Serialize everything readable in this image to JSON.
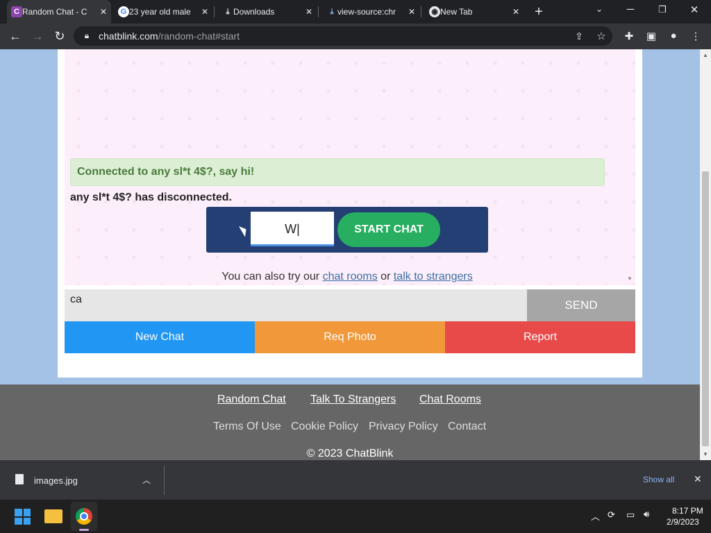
{
  "browser": {
    "tabs": [
      {
        "label": "Random Chat - C",
        "icon": "chatblink-icon"
      },
      {
        "label": "23 year old male",
        "icon": "google-icon"
      },
      {
        "label": "Downloads",
        "icon": "download-icon"
      },
      {
        "label": "view-source:chr",
        "icon": "download-icon"
      },
      {
        "label": "New Tab",
        "icon": "chrome-icon"
      }
    ],
    "url_host": "chatblink.com",
    "url_path": "/random-chat#start"
  },
  "chat": {
    "connected_msg": "Connected to any sl*t 4$?, say hi!",
    "disconnected_msg": "any sl*t 4$? has disconnected.",
    "start_input_value": "W|",
    "start_button": "START CHAT",
    "also_try_prefix": "You can also try our",
    "chat_rooms_link": "chat rooms",
    "or_text": "or",
    "talk_link": "talk to strangers",
    "message_value": "ca",
    "send_button": "SEND",
    "new_chat": "New Chat",
    "req_photo": "Req Photo",
    "report": "Report"
  },
  "footer": {
    "links": [
      "Random Chat",
      "Talk To Strangers",
      "Chat Rooms"
    ],
    "links2": [
      "Terms Of Use",
      "Cookie Policy",
      "Privacy Policy",
      "Contact"
    ],
    "copyright": "© 2023 ChatBlink"
  },
  "downloads": {
    "file": "images.jpg",
    "show_all": "Show all"
  },
  "taskbar": {
    "time": "8:17 PM",
    "date": "2/9/2023"
  },
  "colors": {
    "new_chat": "#2196f3",
    "req_photo": "#f0983a",
    "report": "#e84a4a",
    "start_chat": "#27ae60",
    "start_box": "#243f74"
  }
}
